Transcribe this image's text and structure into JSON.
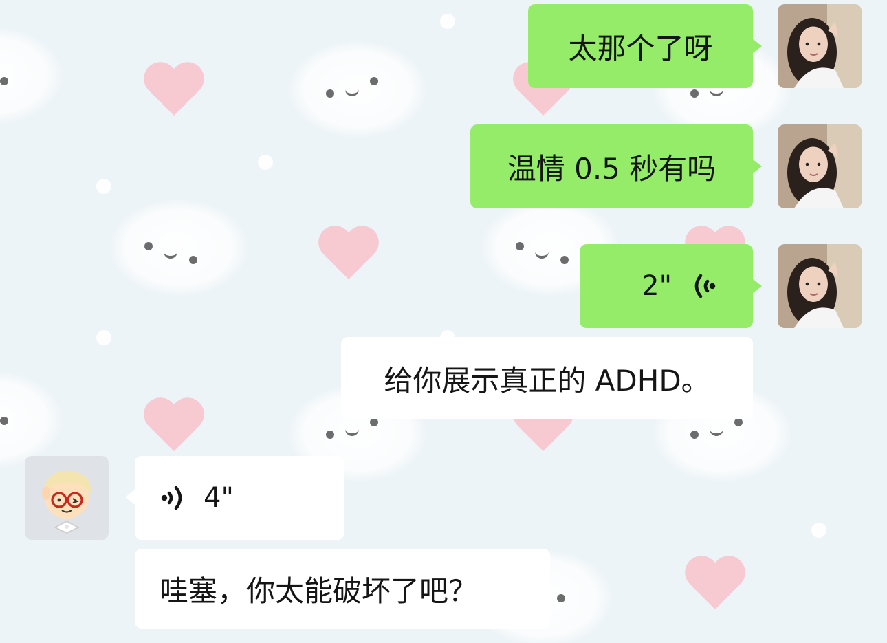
{
  "chat": {
    "messages": [
      {
        "side": "self",
        "type": "text",
        "text": "太那个了呀"
      },
      {
        "side": "self",
        "type": "text",
        "text": "温情 0.5 秒有吗"
      },
      {
        "side": "self",
        "type": "voice",
        "duration": "2\""
      },
      {
        "side": "self",
        "type": "text",
        "text": "给你展示真正的 ADHD。"
      },
      {
        "side": "other",
        "type": "voice",
        "duration": "4\""
      },
      {
        "side": "other",
        "type": "text",
        "text": "哇塞，你太能破坏了吧？"
      }
    ]
  },
  "colors": {
    "self_bubble": "#95ec69",
    "other_bubble": "#ffffff",
    "background": "#edf4f7",
    "heart": "#f7c9d0"
  },
  "icons": {
    "self_avatar": "girl-photo-avatar",
    "other_avatar": "cartoon-avatar",
    "voice": "voice-wave-icon"
  }
}
